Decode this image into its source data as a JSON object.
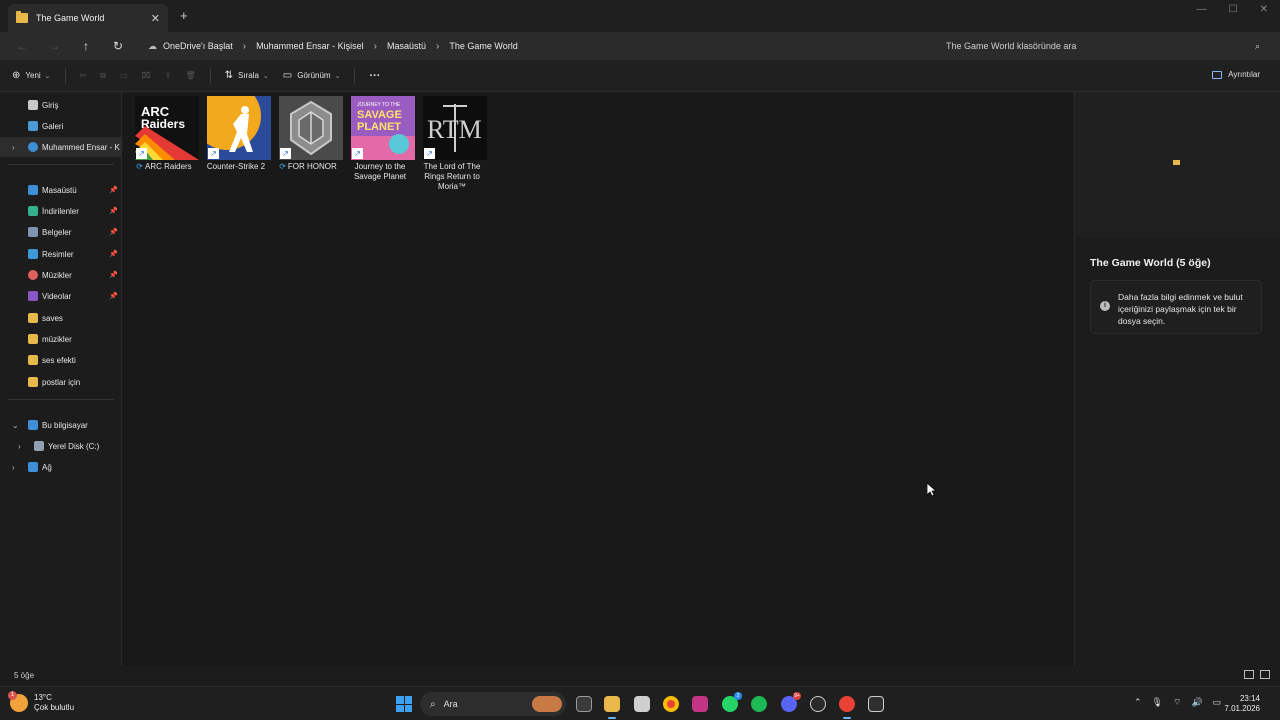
{
  "window": {
    "tab_title": "The Game World",
    "tab_close": "✕",
    "new_tab": "+",
    "min": "—",
    "max": "☐",
    "close": "✕"
  },
  "address": {
    "back": "←",
    "forward": "→",
    "up": "↑",
    "refresh": "↻",
    "breadcrumbs": [
      "OneDrive'ı Başlat",
      "Muhammed Ensar - Kişisel",
      "Masaüstü",
      "The Game World"
    ],
    "separator": "›",
    "search_placeholder": "The Game World klasöründe ara"
  },
  "toolbar": {
    "new_label": "Yeni",
    "sort_label": "Sırala",
    "view_label": "Görünüm",
    "more_label": "···",
    "details_label": "Ayrıntılar"
  },
  "sidebar": {
    "items": [
      {
        "label": "Giriş",
        "icon": "home-icon",
        "color": "#c9c9c9"
      },
      {
        "label": "Galeri",
        "icon": "gallery-icon",
        "color": "#4a9ad8"
      },
      {
        "label": "Muhammed Ensar - Ki",
        "icon": "onedrive-icon",
        "color": "#3d8fd8"
      },
      {
        "label": "Masaüstü",
        "icon": "desktop-icon",
        "color": "#3d8fd8"
      },
      {
        "label": "İndirilenler",
        "icon": "downloads-icon",
        "color": "#34b08a"
      },
      {
        "label": "Belgeler",
        "icon": "documents-icon",
        "color": "#7d93b0"
      },
      {
        "label": "Resimler",
        "icon": "pictures-icon",
        "color": "#3d9ad8"
      },
      {
        "label": "Müzikler",
        "icon": "music-icon",
        "color": "#e06060"
      },
      {
        "label": "Videolar",
        "icon": "videos-icon",
        "color": "#8a55c8"
      },
      {
        "label": "saves",
        "icon": "folder-icon",
        "color": "#e8b94a"
      },
      {
        "label": "müzikler",
        "icon": "folder-icon",
        "color": "#e8b94a"
      },
      {
        "label": "ses efekti",
        "icon": "folder-icon",
        "color": "#e8b94a"
      },
      {
        "label": "postlar için",
        "icon": "folder-icon",
        "color": "#e8b94a"
      },
      {
        "label": "Bu bilgisayar",
        "icon": "pc-icon",
        "color": "#3d8fd8"
      },
      {
        "label": "Yerel Disk (C:)",
        "icon": "disk-icon",
        "color": "#8fa0b0"
      },
      {
        "label": "Ağ",
        "icon": "network-icon",
        "color": "#3d8fd8"
      }
    ]
  },
  "files": [
    {
      "name": "ARC Raiders",
      "sync": "⟳",
      "thumb_bg": "#111111",
      "thumb_text": "ARC Raiders",
      "thumb_fg": "#ffffff"
    },
    {
      "name": "Counter-Strike 2",
      "sync": "",
      "thumb_bg": "#f2a91e",
      "thumb_text": "",
      "thumb_fg": "#233b7a"
    },
    {
      "name": "FOR HONOR",
      "sync": "⟳",
      "thumb_bg": "#5a5a5a",
      "thumb_text": "",
      "thumb_fg": "#cfcfcf"
    },
    {
      "name": "Journey to the Savage Planet",
      "sync": "",
      "thumb_bg": "#8a4fb0",
      "thumb_text": "SAVAGE PLANET",
      "thumb_fg": "#ffe36a"
    },
    {
      "name": "The Lord of The Rings Return to Moria™",
      "sync": "",
      "thumb_bg": "#0d0d0d",
      "thumb_text": "RTM",
      "thumb_fg": "#d0d0d0"
    }
  ],
  "details": {
    "title": "The Game World (5 öğe)",
    "info": "Daha fazla bilgi edinmek ve bulut içeriğinizi paylaşmak için tek bir dosya seçin."
  },
  "status": {
    "count": "5 öğe"
  },
  "taskbar": {
    "temp": "13°C",
    "weather": "Çok bulutlu",
    "weather_badge": "1",
    "search_label": "Ara",
    "time": "23:14",
    "date": "7.01.2026",
    "whatsapp_badge": "2",
    "discord_badge": "9+"
  }
}
